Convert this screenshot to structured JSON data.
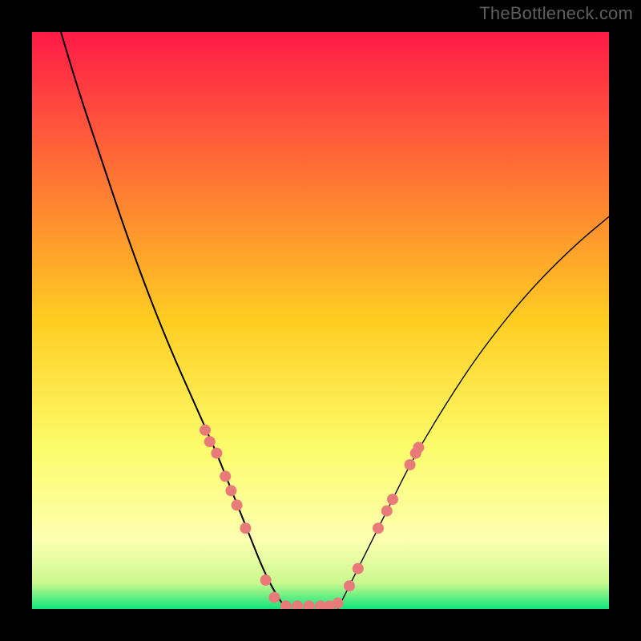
{
  "watermark": "TheBottleneck.com",
  "chart_data": {
    "type": "line",
    "title": "",
    "xlabel": "",
    "ylabel": "",
    "xlim": [
      0,
      100
    ],
    "ylim": [
      0,
      100
    ],
    "background": {
      "type": "vertical-gradient",
      "stops": [
        {
          "pos": 0.0,
          "color": "#ff1a47"
        },
        {
          "pos": 0.5,
          "color": "#ffcd22"
        },
        {
          "pos": 0.72,
          "color": "#fcfc6a"
        },
        {
          "pos": 0.88,
          "color": "#fcffb0"
        },
        {
          "pos": 0.955,
          "color": "#caf98e"
        },
        {
          "pos": 1.0,
          "color": "#10e57a"
        }
      ]
    },
    "series": [
      {
        "name": "left-branch",
        "stroke": "#000000",
        "x": [
          5,
          8,
          12,
          16,
          20,
          24,
          28,
          32,
          34,
          36,
          38,
          40,
          42,
          44
        ],
        "y": [
          100,
          90,
          78,
          66,
          55,
          45,
          36,
          27,
          22,
          17,
          12,
          7,
          3,
          0
        ]
      },
      {
        "name": "right-branch",
        "stroke": "#000000",
        "x": [
          53,
          55,
          58,
          62,
          66,
          72,
          78,
          86,
          94,
          100
        ],
        "y": [
          0,
          4,
          10,
          18,
          26,
          36,
          45,
          55,
          63,
          68
        ]
      }
    ],
    "markers": {
      "name": "highlight-dots",
      "color": "#e97a7a",
      "radius": 7,
      "points": [
        {
          "x": 30,
          "y": 31
        },
        {
          "x": 30.8,
          "y": 29
        },
        {
          "x": 32,
          "y": 27
        },
        {
          "x": 33.5,
          "y": 23
        },
        {
          "x": 34.5,
          "y": 20.5
        },
        {
          "x": 35.5,
          "y": 18
        },
        {
          "x": 37,
          "y": 14
        },
        {
          "x": 40.5,
          "y": 5
        },
        {
          "x": 42,
          "y": 2
        },
        {
          "x": 44,
          "y": 0.5
        },
        {
          "x": 46,
          "y": 0.5
        },
        {
          "x": 48,
          "y": 0.5
        },
        {
          "x": 50,
          "y": 0.5
        },
        {
          "x": 51.5,
          "y": 0.5
        },
        {
          "x": 53,
          "y": 1
        },
        {
          "x": 55,
          "y": 4
        },
        {
          "x": 56.5,
          "y": 7
        },
        {
          "x": 60,
          "y": 14
        },
        {
          "x": 61.5,
          "y": 17
        },
        {
          "x": 62.5,
          "y": 19
        },
        {
          "x": 65.5,
          "y": 25
        },
        {
          "x": 66.5,
          "y": 27
        },
        {
          "x": 67,
          "y": 28
        }
      ]
    }
  }
}
